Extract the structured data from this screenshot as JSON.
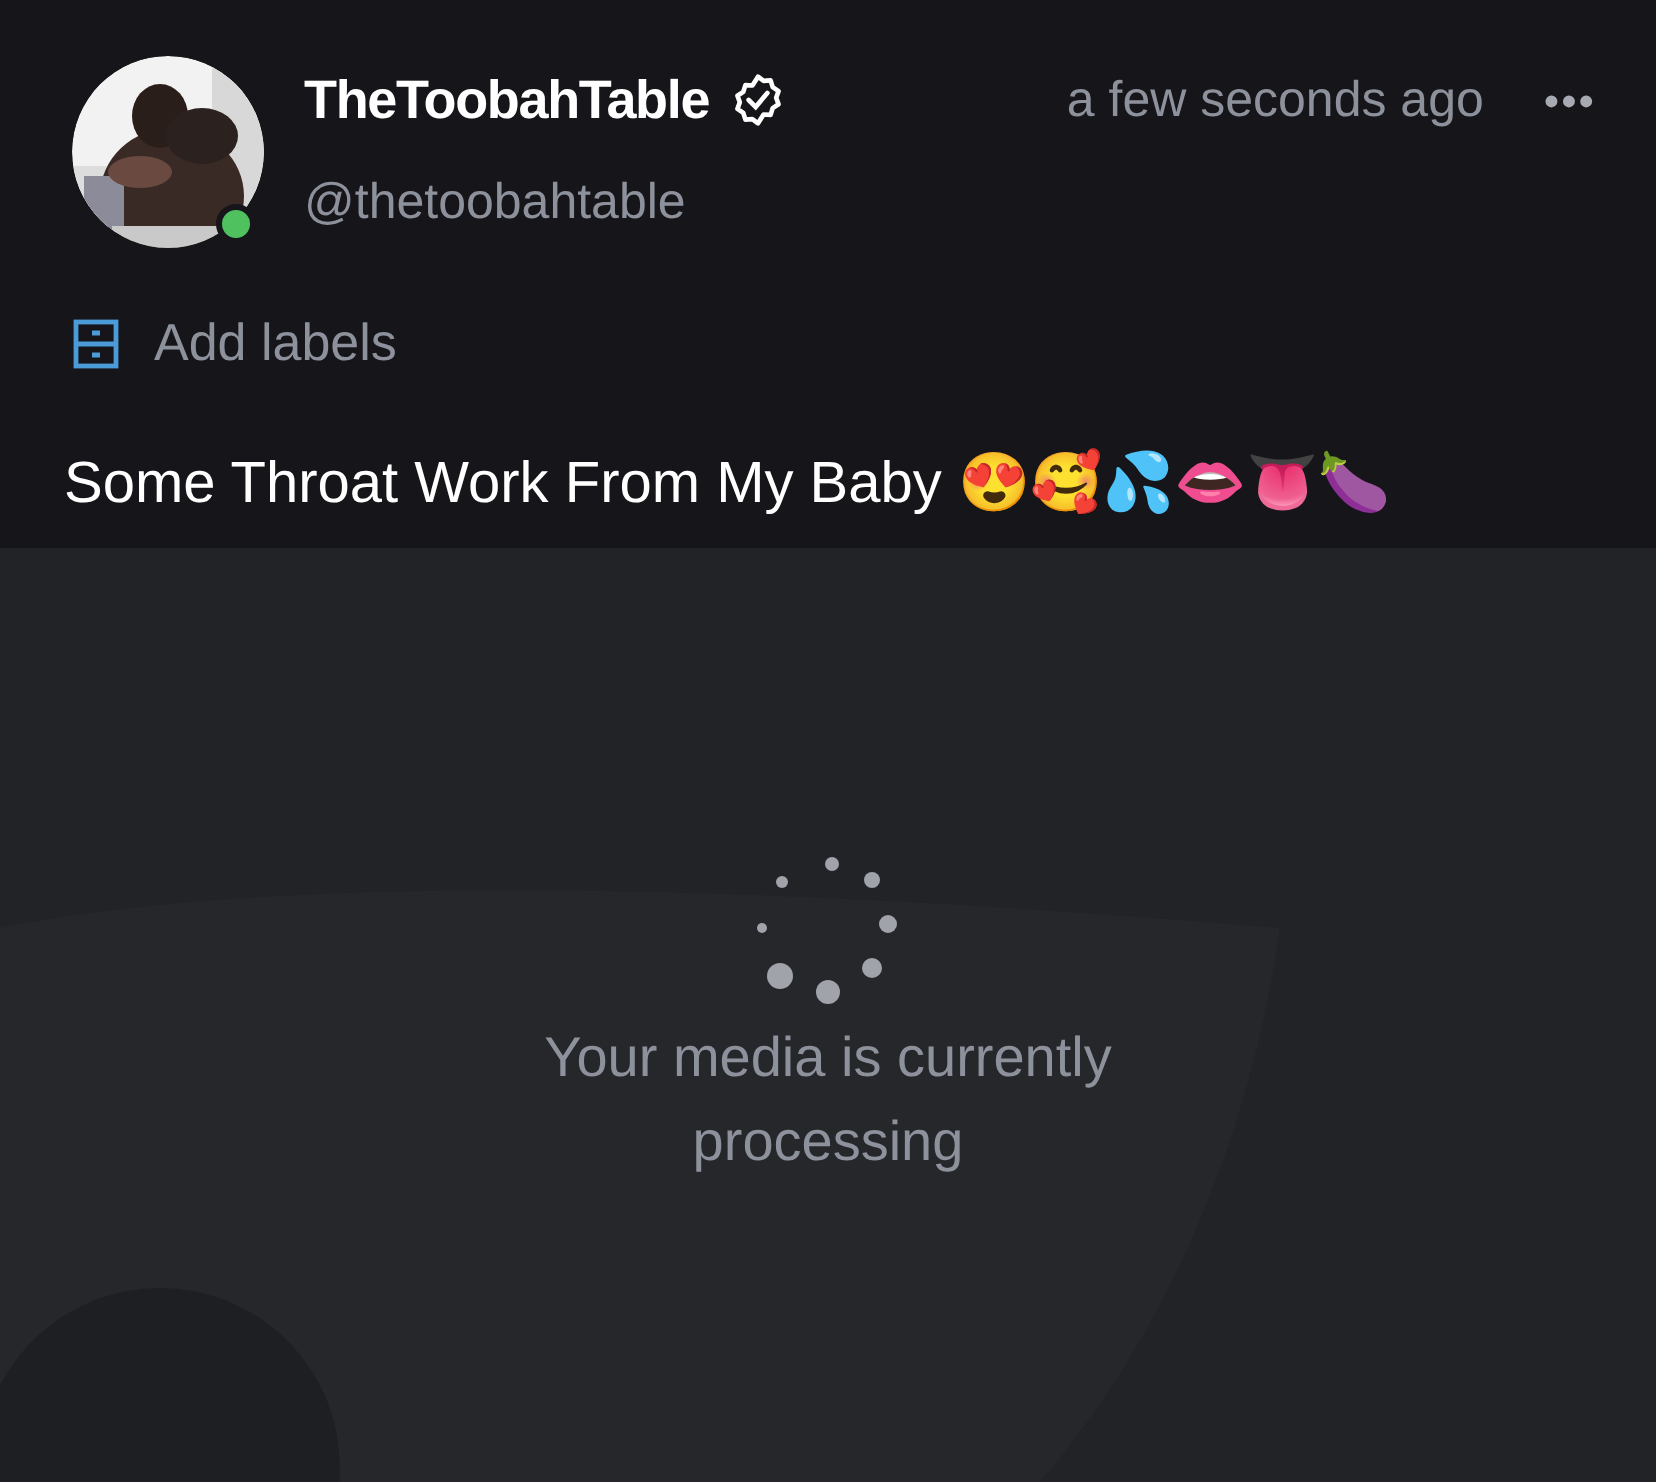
{
  "post": {
    "author": {
      "name": "TheToobahTable",
      "verified": true,
      "handle": "@thetoobahtable",
      "online": true
    },
    "time": "a few seconds ago",
    "more": "•••",
    "labels_link": "Add labels",
    "caption": "Some Throat Work From My Baby 😍🥰💦👄👅🍆",
    "media": {
      "processing": true,
      "message": "Your media is currently processing"
    }
  }
}
